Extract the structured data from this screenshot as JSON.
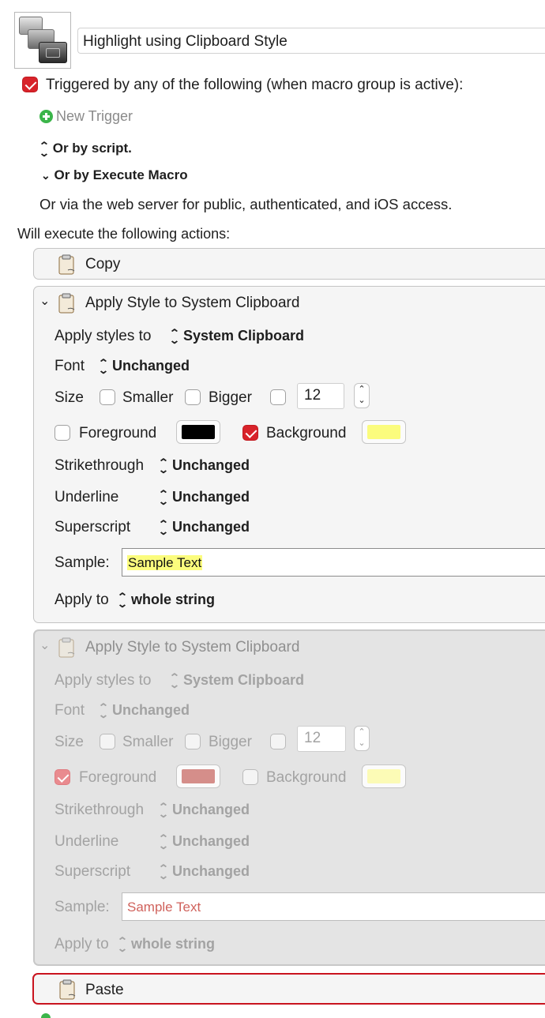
{
  "macro": {
    "title": "Highlight using Clipboard Style"
  },
  "triggers": {
    "enabled": true,
    "heading": "Triggered by any of the following (when macro group is active):",
    "new_trigger_label": "New Trigger",
    "or_by_script_label": "Or by script.",
    "or_by_execute_macro_label": "Or by Execute Macro",
    "web_server_text": "Or via the web server for public, authenticated, and iOS access."
  },
  "actions_heading": "Will execute the following actions:",
  "actions": [
    {
      "title": "Copy",
      "state": "normal"
    },
    {
      "title": "Apply Style to System Clipboard",
      "state": "expanded",
      "apply_styles_label": "Apply styles to",
      "apply_styles_value": "System Clipboard",
      "font_label": "Font",
      "font_value": "Unchanged",
      "size_label": "Size",
      "smaller_label": "Smaller",
      "smaller_checked": false,
      "bigger_label": "Bigger",
      "bigger_checked": false,
      "size_checked": false,
      "size_value": "12",
      "foreground_label": "Foreground",
      "foreground_checked": false,
      "foreground_color": "#000000",
      "background_label": "Background",
      "background_checked": true,
      "background_color": "#fbfc7d",
      "strikethrough_label": "Strikethrough",
      "strikethrough_value": "Unchanged",
      "underline_label": "Underline",
      "underline_value": "Unchanged",
      "superscript_label": "Superscript",
      "superscript_value": "Unchanged",
      "sample_label": "Sample:",
      "sample_text": "Sample Text",
      "apply_to_label": "Apply to",
      "apply_to_value": "whole string"
    },
    {
      "title": "Apply Style to System Clipboard",
      "state": "disabled",
      "apply_styles_label": "Apply styles to",
      "apply_styles_value": "System Clipboard",
      "font_label": "Font",
      "font_value": "Unchanged",
      "size_label": "Size",
      "smaller_label": "Smaller",
      "smaller_checked": false,
      "bigger_label": "Bigger",
      "bigger_checked": false,
      "size_checked": false,
      "size_value": "12",
      "foreground_label": "Foreground",
      "foreground_checked": true,
      "foreground_color": "#d58e8a",
      "background_label": "Background",
      "background_checked": false,
      "background_color": "#fcfbb6",
      "strikethrough_label": "Strikethrough",
      "strikethrough_value": "Unchanged",
      "underline_label": "Underline",
      "underline_value": "Unchanged",
      "superscript_label": "Superscript",
      "superscript_value": "Unchanged",
      "sample_label": "Sample:",
      "sample_text": "Sample Text",
      "sample_text_color": "#d0625c",
      "apply_to_label": "Apply to",
      "apply_to_value": "whole string"
    },
    {
      "title": "Paste",
      "state": "selected"
    }
  ],
  "icons": {
    "macro_icon": "stacked-windows-icon",
    "clipboard_icon": "clipboard-icon",
    "add_icon": "plus-circle-icon",
    "updown_icon": "chevron-updown-icon",
    "disclosure_icon": "chevron-down-icon"
  },
  "colors": {
    "accent_red": "#d8232a",
    "add_green": "#3bb54a",
    "selection_border": "#c9141f"
  }
}
